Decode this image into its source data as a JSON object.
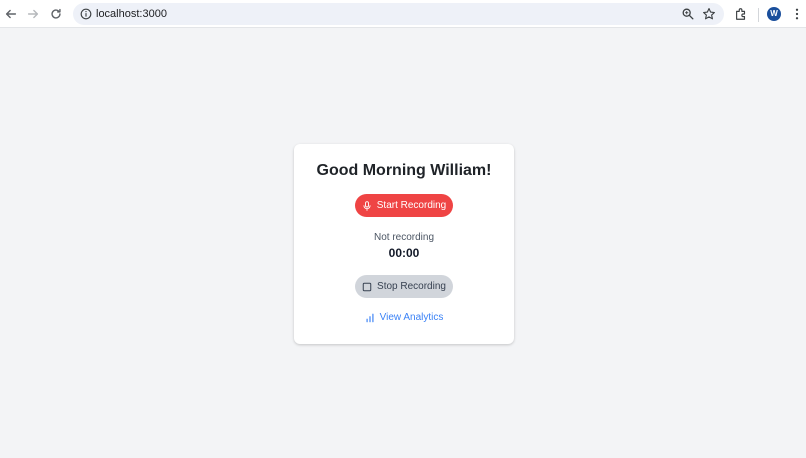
{
  "browser": {
    "url": "localhost:3000",
    "profile_initial": "W"
  },
  "card": {
    "greeting": "Good Morning William!",
    "start_label": "Start Recording",
    "status": "Not recording",
    "timer": "00:00",
    "stop_label": "Stop Recording",
    "analytics_label": "View Analytics"
  },
  "colors": {
    "accent_red": "#ef4444",
    "link_blue": "#3b82f6",
    "disabled_gray": "#d1d5db",
    "page_bg": "#f3f4f6"
  },
  "icons": {
    "back": "arrow-left-icon",
    "forward": "arrow-right-icon",
    "reload": "reload-icon",
    "site_info": "site-info-icon",
    "zoom": "zoom-icon",
    "bookmark": "star-icon",
    "extensions": "puzzle-icon",
    "menu": "kebab-menu-icon",
    "mic": "microphone-icon",
    "stop": "stop-square-icon",
    "analytics": "bar-chart-icon"
  }
}
